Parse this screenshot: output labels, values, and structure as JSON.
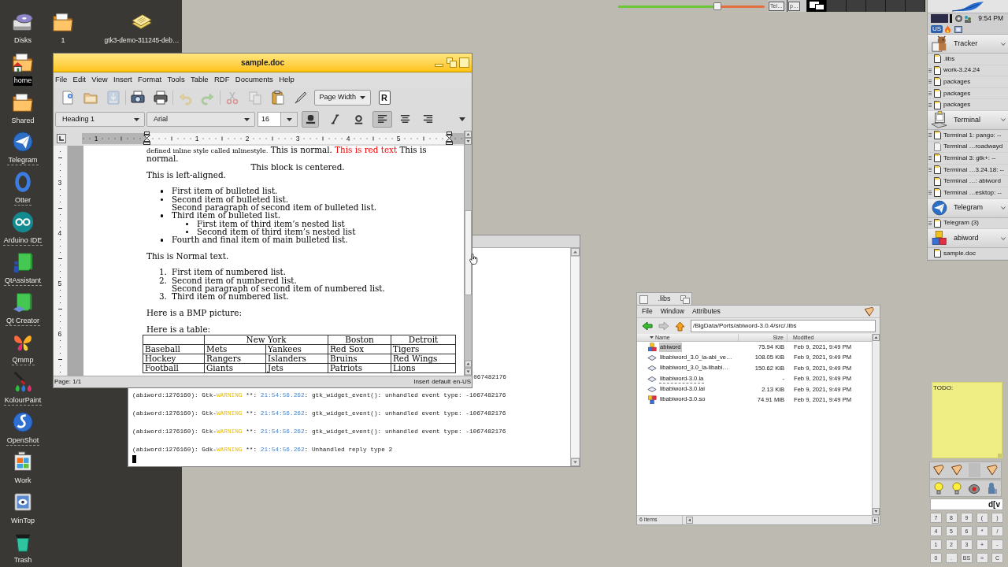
{
  "desktop_icons": [
    {
      "label": "Disks",
      "selected": false,
      "link": false
    },
    {
      "label": "home",
      "selected": true,
      "link": false
    },
    {
      "label": "Shared",
      "selected": false,
      "link": false
    },
    {
      "label": "Telegram",
      "selected": false,
      "link": true
    },
    {
      "label": "Otter",
      "selected": false,
      "link": true
    },
    {
      "label": "Arduino IDE",
      "selected": false,
      "link": true
    },
    {
      "label": "QtAssistant",
      "selected": false,
      "link": true
    },
    {
      "label": "Qt Creator",
      "selected": false,
      "link": true
    },
    {
      "label": "Qmmp",
      "selected": false,
      "link": true
    },
    {
      "label": "KolourPaint",
      "selected": false,
      "link": true
    },
    {
      "label": "OpenShot",
      "selected": false,
      "link": true
    },
    {
      "label": "Work",
      "selected": false,
      "link": false
    },
    {
      "label": "WinTop",
      "selected": false,
      "link": false
    },
    {
      "label": "Trash",
      "selected": false,
      "link": false
    }
  ],
  "desktop_top_icons": [
    {
      "label": "1",
      "selected": false,
      "link": false
    },
    {
      "label": "gtk3-demo-311245-deb…",
      "selected": false,
      "link": false
    }
  ],
  "top_slider": {
    "level": 0.68
  },
  "workspaces": [
    {
      "selected": false,
      "windows": [
        "Tel…"
      ]
    },
    {
      "selected": false,
      "windows": [
        "p…"
      ]
    },
    {
      "selected": true
    },
    {
      "selected": false
    },
    {
      "selected": false
    },
    {
      "selected": false
    },
    {
      "selected": false
    },
    {
      "selected": false
    }
  ],
  "deskbar": {
    "clock": "9:54 PM",
    "keyboard_layout": "US",
    "groups": [
      {
        "name": "Tracker",
        "items": [
          {
            "label": ".libs",
            "side_mark": false,
            "dimmed": false
          },
          {
            "label": "work-3.24.24",
            "side_mark": true,
            "dimmed": false
          },
          {
            "label": "packages",
            "side_mark": true,
            "dimmed": false
          },
          {
            "label": "packages",
            "side_mark": true,
            "dimmed": false
          },
          {
            "label": "packages",
            "side_mark": true,
            "dimmed": false
          }
        ]
      },
      {
        "name": "Terminal",
        "items": [
          {
            "label": "Terminal 1: pango: --",
            "side_mark": true,
            "dimmed": false
          },
          {
            "label": "Terminal …roadwayd",
            "side_mark": false,
            "dimmed": true
          },
          {
            "label": "Terminal 3: gtk+: --",
            "side_mark": true,
            "dimmed": false
          },
          {
            "label": "Terminal …3.24.18: --",
            "side_mark": true,
            "dimmed": false
          },
          {
            "label": "Terminal …: abiword",
            "side_mark": false,
            "dimmed": false
          },
          {
            "label": "Terminal …esktop: --",
            "side_mark": true,
            "dimmed": false
          }
        ]
      },
      {
        "name": "Telegram",
        "items": [
          {
            "label": "Telegram (3)",
            "side_mark": true,
            "dimmed": false
          }
        ]
      },
      {
        "name": "abiword",
        "items": [
          {
            "label": "sample.doc",
            "side_mark": false,
            "dimmed": false
          }
        ]
      }
    ]
  },
  "abiword": {
    "title": "sample.doc",
    "menu": [
      "File",
      "Edit",
      "View",
      "Insert",
      "Format",
      "Tools",
      "Table",
      "RDF",
      "Documents",
      "Help"
    ],
    "toolbar": [
      {
        "disabled": false
      },
      {
        "disabled": false
      },
      {
        "disabled": true
      },
      {
        "disabled": false
      },
      {
        "disabled": false
      },
      {
        "disabled": true
      },
      {
        "disabled": true
      },
      {
        "disabled": true
      },
      {
        "disabled": true
      },
      {
        "disabled": false
      },
      {
        "disabled": false
      }
    ],
    "zoom": "Page Width",
    "letter_button": "R",
    "style": "Heading 1",
    "font": "Arial",
    "size": "16",
    "text_toggles": [
      {
        "on": true
      },
      {
        "on": false
      },
      {
        "on": false
      }
    ],
    "alignment": [
      {
        "selected": true
      },
      {
        "selected": false
      },
      {
        "selected": false
      }
    ],
    "ruler_numbers": [
      "1",
      "1",
      "2",
      "3",
      "4",
      "5"
    ],
    "side_ruler_numbers": [
      "3",
      "4",
      "5",
      "6"
    ],
    "document": [
      {
        "kind": "paragraph",
        "centered": false,
        "runs": [
          {
            "kind": "styled",
            "text": "defined inline style called inlinestyle."
          },
          {
            "kind": "plain",
            "text": " This is normal. "
          },
          {
            "kind": "plain",
            "text": "This is red text",
            "color": "#ff0000"
          },
          {
            "kind": "plain",
            "text": " This is normal."
          }
        ]
      },
      {
        "kind": "paragraph",
        "centered": true,
        "text": "This block is centered."
      },
      {
        "kind": "paragraph",
        "centered": false,
        "text": "This is left-aligned."
      },
      {
        "kind": "bulleted_list",
        "items": [
          {
            "paragraphs": [
              "First item of bulleted list."
            ]
          },
          {
            "paragraphs": [
              "Second item of bulleted list.",
              "Second paragraph of second item of bulleted list."
            ]
          },
          {
            "paragraphs": [
              "Third item of bulleted list."
            ],
            "children": [
              {
                "paragraphs": [
                  "First item of third item’s nested list"
                ]
              },
              {
                "paragraphs": [
                  "Second item of third item’s nested list"
                ]
              }
            ]
          },
          {
            "paragraphs": [
              "Fourth and final item of main bulleted list."
            ]
          }
        ]
      },
      {
        "kind": "paragraph",
        "centered": false,
        "text": "This is Normal text."
      },
      {
        "kind": "numbered_list",
        "items": [
          {
            "number": "1.",
            "paragraphs": [
              "First item of numbered list."
            ]
          },
          {
            "number": "2.",
            "paragraphs": [
              "Second item of numbered list.",
              "Second paragraph of second item of numbered list."
            ]
          },
          {
            "number": "3.",
            "paragraphs": [
              "Third item of numbered list."
            ]
          }
        ]
      },
      {
        "kind": "paragraph",
        "centered": false,
        "text": "Here is a BMP picture:"
      },
      {
        "kind": "paragraph",
        "centered": false,
        "text": "Here is a table:"
      },
      {
        "kind": "table",
        "header": [
          {
            "kind": "blank"
          },
          {
            "kind": "double",
            "text": "New York"
          },
          {
            "kind": "single",
            "text": "Boston"
          },
          {
            "kind": "single",
            "text": "Detroit"
          }
        ],
        "rows": [
          [
            "Baseball",
            "Mets",
            "Yankees",
            "Red Sox",
            "Tigers"
          ],
          [
            "Hockey",
            "Rangers",
            "Islanders",
            "Bruins",
            "Red Wings"
          ],
          [
            "Football",
            "Giants",
            "Jets",
            "Patriots",
            "Lions"
          ]
        ]
      }
    ],
    "status": {
      "page": "Page: 1/1",
      "mode": "Insert",
      "style": "default",
      "language": "en-US"
    }
  },
  "terminal": {
    "lines": [
      {
        "kind": "tail",
        "segments": [
          {
            "kind": "plain",
            "text": "067482176"
          }
        ]
      },
      {
        "kind": "full",
        "segments": [
          {
            "kind": "plain",
            "text": "(abiword:1276160): Gtk-"
          },
          {
            "kind": "level",
            "text": "WARNING"
          },
          {
            "kind": "plain",
            "text": " **: "
          },
          {
            "kind": "time",
            "text": "21:54:56.262"
          },
          {
            "kind": "plain",
            "text": ": gtk_widget_event(): unhandled event type: -1067482176"
          }
        ]
      },
      {
        "kind": "full",
        "segments": [
          {
            "kind": "plain",
            "text": "(abiword:1276160): Gtk-"
          },
          {
            "kind": "level",
            "text": "WARNING"
          },
          {
            "kind": "plain",
            "text": " **: "
          },
          {
            "kind": "time",
            "text": "21:54:56.262"
          },
          {
            "kind": "plain",
            "text": ": gtk_widget_event(): unhandled event type: -1067482176"
          }
        ]
      },
      {
        "kind": "full",
        "segments": [
          {
            "kind": "plain",
            "text": "(abiword:1276160): Gtk-"
          },
          {
            "kind": "level",
            "text": "WARNING"
          },
          {
            "kind": "plain",
            "text": " **: "
          },
          {
            "kind": "time",
            "text": "21:54:56.262"
          },
          {
            "kind": "plain",
            "text": ": gtk_widget_event(): unhandled event type: -1067482176"
          }
        ]
      },
      {
        "kind": "full",
        "segments": [
          {
            "kind": "plain",
            "text": "(abiword:1276160): Gdk-"
          },
          {
            "kind": "level",
            "text": "WARNING"
          },
          {
            "kind": "plain",
            "text": " **: "
          },
          {
            "kind": "time",
            "text": "21:54:56.262"
          },
          {
            "kind": "plain",
            "text": ": Unhandled reply type 2"
          }
        ]
      }
    ]
  },
  "file_manager": {
    "title": ".libs",
    "menu": [
      "File",
      "Window",
      "Attributes"
    ],
    "path": "/BigData/Ports/abiword-3.0.4/src/.libs",
    "columns": [
      "Name",
      "Size",
      "Modified"
    ],
    "rows": [
      {
        "kind": "application",
        "name": "abiword",
        "size": "75.94 KiB",
        "modified": "Feb 9, 2021, 9:49 PM",
        "selected": true,
        "link": false
      },
      {
        "kind": "file",
        "name": "libabiword_3.0_la-abi_ve…",
        "size": "108.05 KiB",
        "modified": "Feb 9, 2021, 9:49 PM",
        "selected": false,
        "link": false
      },
      {
        "kind": "file",
        "name": "libabiword_3.0_la-libabi…",
        "size": "150.62 KiB",
        "modified": "Feb 9, 2021, 9:49 PM",
        "selected": false,
        "link": false
      },
      {
        "kind": "file",
        "name": "libabiword-3.0.la",
        "size": "-",
        "modified": "Feb 9, 2021, 9:49 PM",
        "selected": false,
        "link": true
      },
      {
        "kind": "file",
        "name": "libabiword-3.0.lai",
        "size": "2.13 KiB",
        "modified": "Feb 9, 2021, 9:49 PM",
        "selected": false,
        "link": false
      },
      {
        "kind": "library",
        "name": "libabiword-3.0.so",
        "size": "74.91 MiB",
        "modified": "Feb 9, 2021, 9:49 PM",
        "selected": false,
        "link": false
      }
    ],
    "status": "6 items"
  },
  "sticky_note": {
    "text": "TODO:"
  },
  "calculator": {
    "display": "d[v",
    "keys": [
      "7",
      "8",
      "9",
      "(",
      ")",
      "4",
      "5",
      "6",
      "*",
      "/",
      "1",
      "2",
      "3",
      "+",
      "-",
      "0",
      ".",
      "BS",
      "=",
      "C"
    ]
  }
}
